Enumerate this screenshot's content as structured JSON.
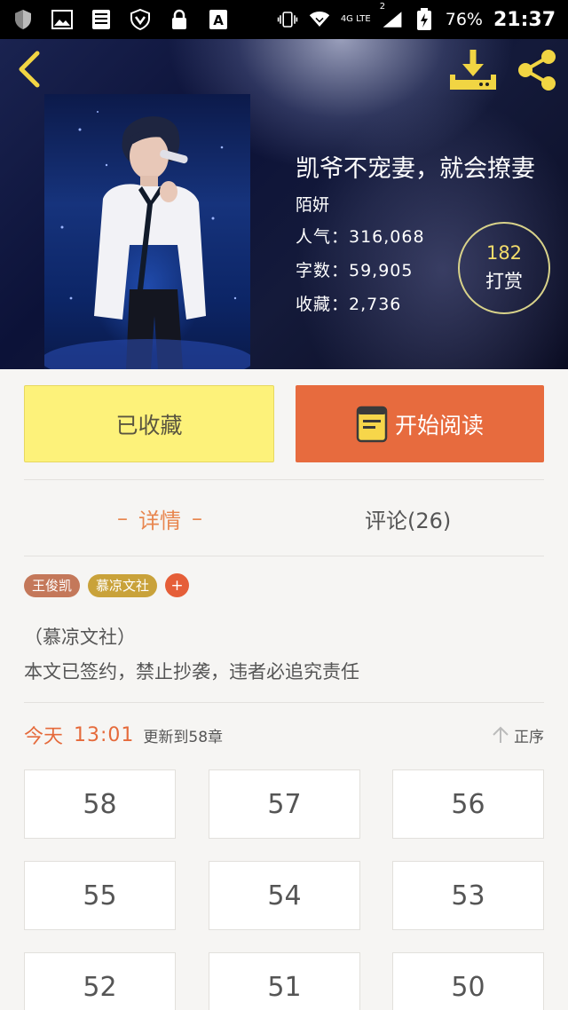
{
  "status_bar": {
    "network": "4G LTE",
    "sim": "2",
    "battery": "76%",
    "time": "21:37"
  },
  "header": {
    "back_icon": "chevron-left-icon",
    "download_icon": "download-icon",
    "share_icon": "share-icon"
  },
  "book": {
    "title": "凯爷不宠妻，就会撩妻",
    "author": "陌妍",
    "popularity": "人气：316,068",
    "words": "字数：59,905",
    "favorites": "收藏：2,736"
  },
  "reward": {
    "count": "182",
    "label": "打赏"
  },
  "actions": {
    "favorited_label": "已收藏",
    "read_label": "开始阅读"
  },
  "tabs": {
    "detail": "详情",
    "detail_dash": "–",
    "comments": "评论(26)"
  },
  "tags": [
    "王俊凯",
    "慕凉文社"
  ],
  "tag_add": "+",
  "description": {
    "line1": "（慕凉文社）",
    "line2": "本文已签约，禁止抄袭，违者必追究责任"
  },
  "update": {
    "day": "今天",
    "time": "13:01",
    "text": "更新到58章",
    "sort": "正序"
  },
  "chapters": [
    "58",
    "57",
    "56",
    "55",
    "54",
    "53",
    "52",
    "51",
    "50"
  ],
  "colors": {
    "accent_orange": "#e76b3e",
    "favorite_yellow": "#fdf27a",
    "reward_gold": "#f3dc6b"
  }
}
